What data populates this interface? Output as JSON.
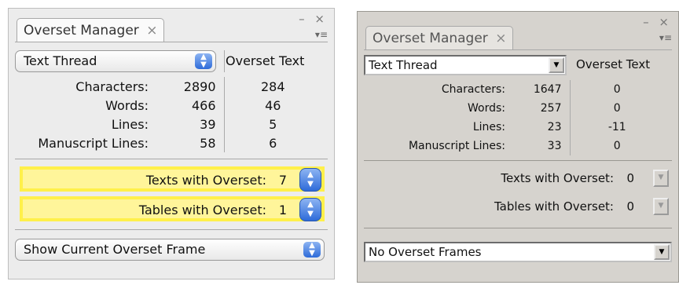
{
  "mac": {
    "tab_title": "Overset Manager",
    "tab_close": "×",
    "window_controls": "– ×",
    "menu_icon": "▾≡",
    "thread_select": "Text Thread",
    "overset_header": "Overset Text",
    "rows": [
      {
        "label": "Characters:",
        "value": "2890",
        "overset": "284"
      },
      {
        "label": "Words:",
        "value": "466",
        "overset": "46"
      },
      {
        "label": "Lines:",
        "value": "39",
        "overset": "5"
      },
      {
        "label": "Manuscript Lines:",
        "value": "58",
        "overset": "6"
      }
    ],
    "texts_with_overset_label": "Texts with Overset:",
    "texts_with_overset_value": "7",
    "tables_with_overset_label": "Tables with Overset:",
    "tables_with_overset_value": "1",
    "frame_select": "Show Current Overset Frame",
    "highlight_color": "#fff59a"
  },
  "win": {
    "tab_title": "Overset Manager",
    "tab_close": "×",
    "window_controls": "– ×",
    "menu_icon": "▾≡",
    "thread_select": "Text Thread",
    "overset_header": "Overset Text",
    "rows": [
      {
        "label": "Characters:",
        "value": "1647",
        "overset": "0"
      },
      {
        "label": "Words:",
        "value": "257",
        "overset": "0"
      },
      {
        "label": "Lines:",
        "value": "23",
        "overset": "-11"
      },
      {
        "label": "Manuscript Lines:",
        "value": "33",
        "overset": "0"
      }
    ],
    "texts_with_overset_label": "Texts with Overset:",
    "texts_with_overset_value": "0",
    "tables_with_overset_label": "Tables with Overset:",
    "tables_with_overset_value": "0",
    "frame_select": "No Overset Frames"
  }
}
